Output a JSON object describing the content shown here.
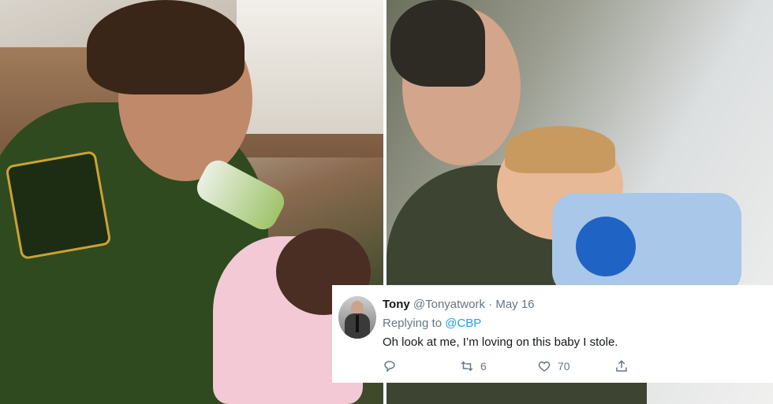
{
  "tweet": {
    "display_name": "Tony",
    "handle": "@Tonyatwork",
    "separator": "·",
    "date": "May 16",
    "replying_prefix": "Replying to",
    "replying_to": "@CBP",
    "text": "Oh look at me, I’m loving on this baby I stole.",
    "retweets": "6",
    "likes": "70"
  },
  "icons": {
    "reply": "reply-icon",
    "retweet": "retweet-icon",
    "like": "heart-icon",
    "share": "share-icon"
  },
  "colors": {
    "link": "#1da1f2",
    "secondary_text": "#657786",
    "primary_text": "#14171a"
  }
}
